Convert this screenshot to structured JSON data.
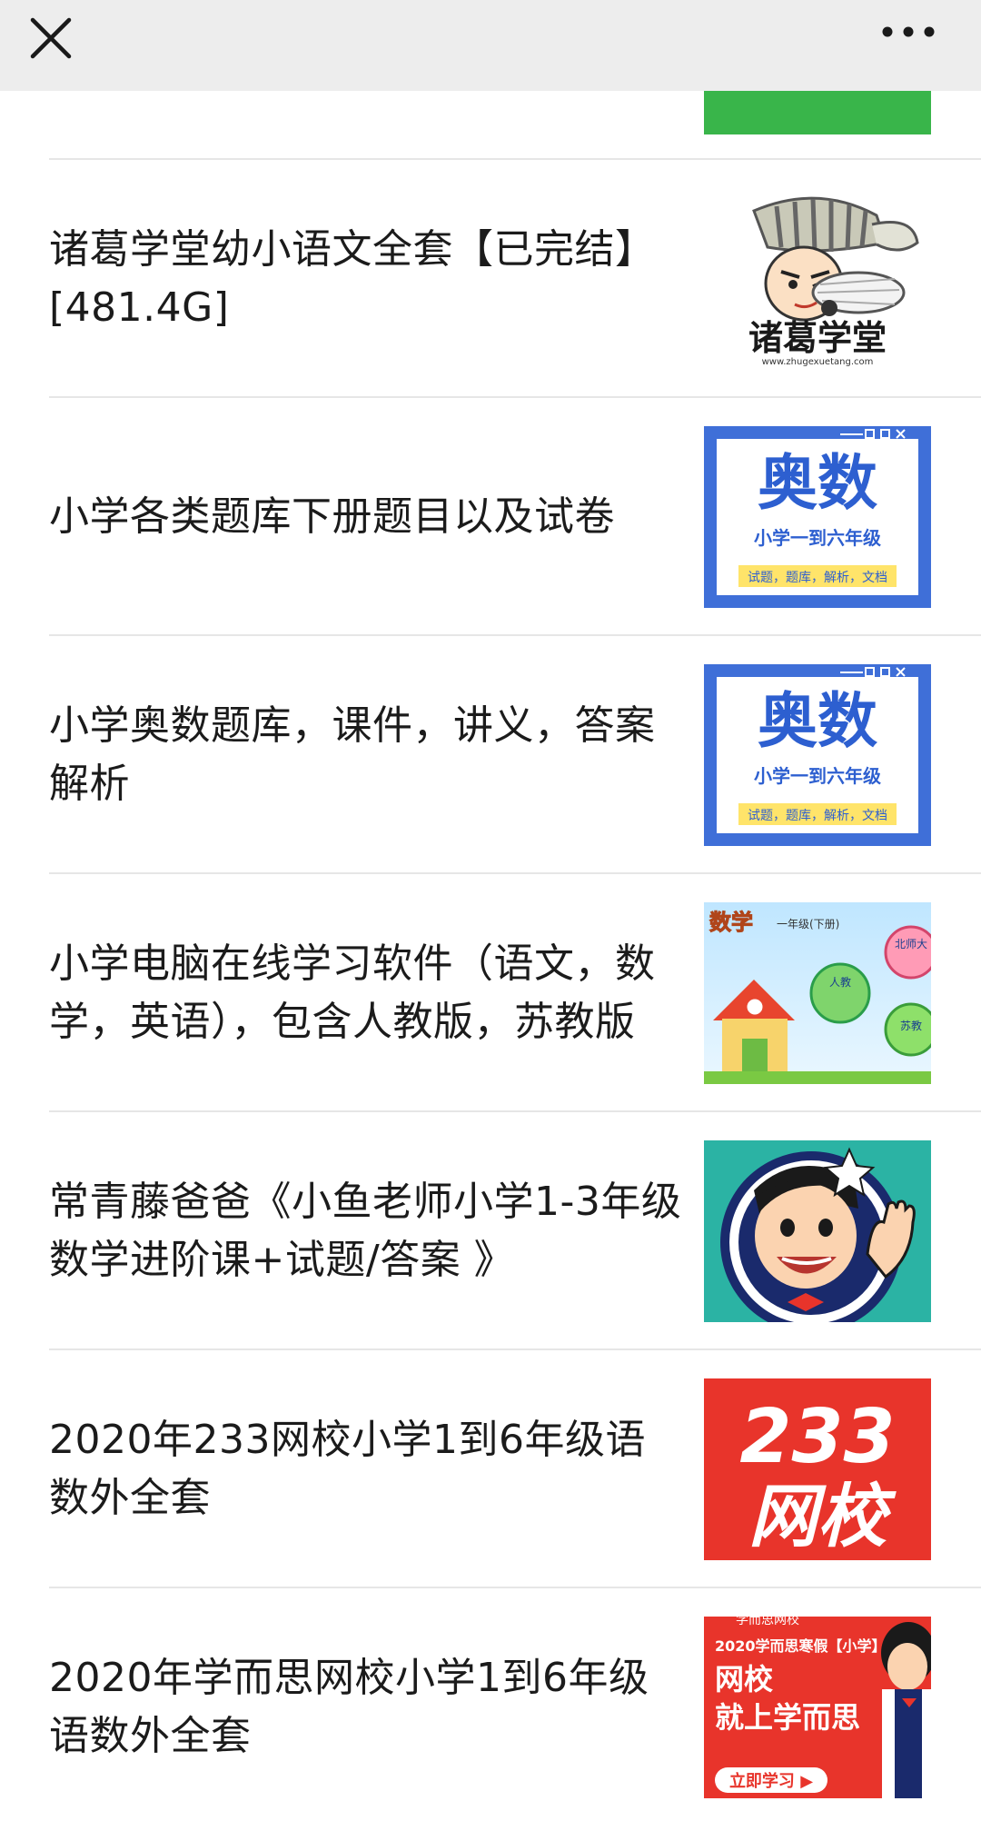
{
  "colors": {
    "topbar_bg": "#ededed",
    "divider": "#e6e6e6",
    "partial_thumb_green": "#39b54a",
    "aoshu_blue": "#3f6fd8",
    "red_brand": "#e8342b",
    "teal": "#2bb3a4"
  },
  "topbar": {
    "close_icon": "close-icon",
    "more_icon": "more-icon"
  },
  "items": [
    {
      "title": "诸葛学堂幼小语文全套【已完结】[481.4G]",
      "thumb": {
        "icon": "zhuge-logo-image",
        "logo_text": "诸葛学堂",
        "url_text": "www.zhugexuetang.com"
      }
    },
    {
      "title": "小学各类题库下册题目以及试卷",
      "thumb": {
        "icon": "aoshu-cover-image",
        "big_text": "奥数",
        "sub_text": "小学一到六年级",
        "tag_text": "试题，题库，解析，文档"
      }
    },
    {
      "title": "小学奥数题库，课件，讲义，答案解析",
      "thumb": {
        "icon": "aoshu-cover-image",
        "big_text": "奥数",
        "sub_text": "小学一到六年级",
        "tag_text": "试题，题库，解析，文档"
      }
    },
    {
      "title": "小学电脑在线学习软件（语文，数学，英语），包含人教版，苏教版",
      "thumb": {
        "icon": "math-software-image",
        "label_math": "数学",
        "label_grade": "一年级(下册)",
        "label_a": "人教",
        "label_b": "苏教",
        "label_c": "北师大"
      }
    },
    {
      "title": "常青藤爸爸《小鱼老师小学1-3年级数学进阶课+试题/答案 》",
      "thumb": {
        "icon": "cartoon-teacher-image"
      }
    },
    {
      "title": "2020年233网校小学1到6年级语数外全套",
      "thumb": {
        "icon": "233-logo-image",
        "line1": "233",
        "line2": "网校"
      }
    },
    {
      "title": "2020年学而思网校小学1到6年级语数外全套",
      "thumb": {
        "icon": "xueersi-ad-image",
        "top_text": "学而思网校",
        "headline": "2020学而思寒假【小学】",
        "line1": "网校",
        "line2": "就上学而思",
        "button_text": "立即学习 ▶"
      }
    }
  ]
}
